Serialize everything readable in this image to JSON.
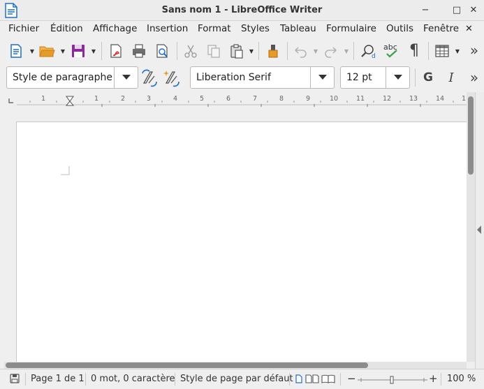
{
  "window": {
    "title": "Sans nom 1 - LibreOffice Writer",
    "buttons": {
      "minimize": "−",
      "maximize": "□",
      "close": "✕"
    }
  },
  "menu": [
    "Fichier",
    "Édition",
    "Affichage",
    "Insertion",
    "Format",
    "Styles",
    "Tableau",
    "Formulaire",
    "Outils",
    "Fenêtre"
  ],
  "menu_close": "✕",
  "toolbar1": {
    "icons": [
      "new-document-icon",
      "open-folder-icon",
      "save-icon",
      "export-pdf-icon",
      "print-icon",
      "print-preview-icon",
      "cut-icon",
      "copy-icon",
      "paste-icon",
      "clone-formatting-icon",
      "undo-icon",
      "redo-icon",
      "find-replace-icon",
      "spellcheck-icon",
      "formatting-marks-icon",
      "insert-table-icon",
      "more-options-icon"
    ],
    "spellcheck_label": "abc",
    "formatting_marks_glyph": "¶",
    "more_glyph": "»"
  },
  "toolbar2": {
    "paragraph_style": "Style de paragraphe",
    "font_name": "Liberation Serif",
    "font_size": "12 pt",
    "bold_label": "G",
    "italic_label": "I",
    "more_glyph": "»"
  },
  "ruler": {
    "left_numbers": [
      "1"
    ],
    "numbers": [
      "1",
      "2",
      "3",
      "4",
      "5",
      "6",
      "7",
      "8",
      "9",
      "10",
      "11",
      "12",
      "13",
      "14",
      "1"
    ]
  },
  "statusbar": {
    "page": "Page 1 de 1",
    "word_count": "0 mot, 0 caractère",
    "page_style": "Style de page par défaut",
    "zoom_minus": "−",
    "zoom_plus": "+",
    "zoom": "100 %"
  },
  "colors": {
    "accent_blue": "#1e6fc7",
    "save_purple": "#8a2a9e",
    "folder_orange": "#e69a28",
    "pdf_red": "#d8312a",
    "spell_green": "#3aa14a"
  }
}
